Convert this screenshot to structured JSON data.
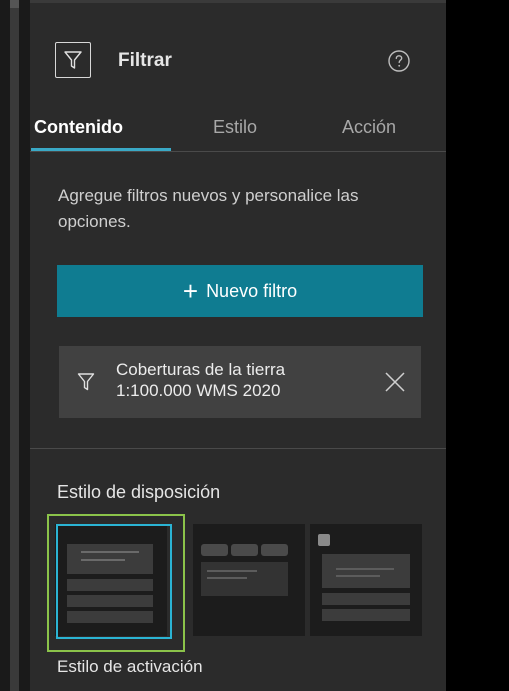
{
  "panel": {
    "title": "Filtrar",
    "icons": {
      "header": "filter-icon",
      "help": "help-icon"
    }
  },
  "tabs": [
    {
      "label": "Contenido",
      "active": true
    },
    {
      "label": "Estilo",
      "active": false
    },
    {
      "label": "Acción",
      "active": false
    }
  ],
  "content": {
    "description": "Agregue filtros nuevos y personalice las opciones.",
    "new_filter_label": "Nuevo filtro",
    "filter_item": {
      "line1": "Coberturas de la tierra",
      "line2": "1:100.000 WMS 2020"
    }
  },
  "layout_style": {
    "title": "Estilo de disposición",
    "options": [
      "list-collapsible",
      "tabs",
      "icon-list"
    ],
    "selected": 0
  },
  "activation_style": {
    "title": "Estilo de activación"
  },
  "colors": {
    "accent": "#0f7c91",
    "tab_underline": "#3aa9c6",
    "selection_outer": "#8bc34a",
    "selection_inner": "#2bb4d4",
    "panel_bg": "#2b2b2b"
  }
}
